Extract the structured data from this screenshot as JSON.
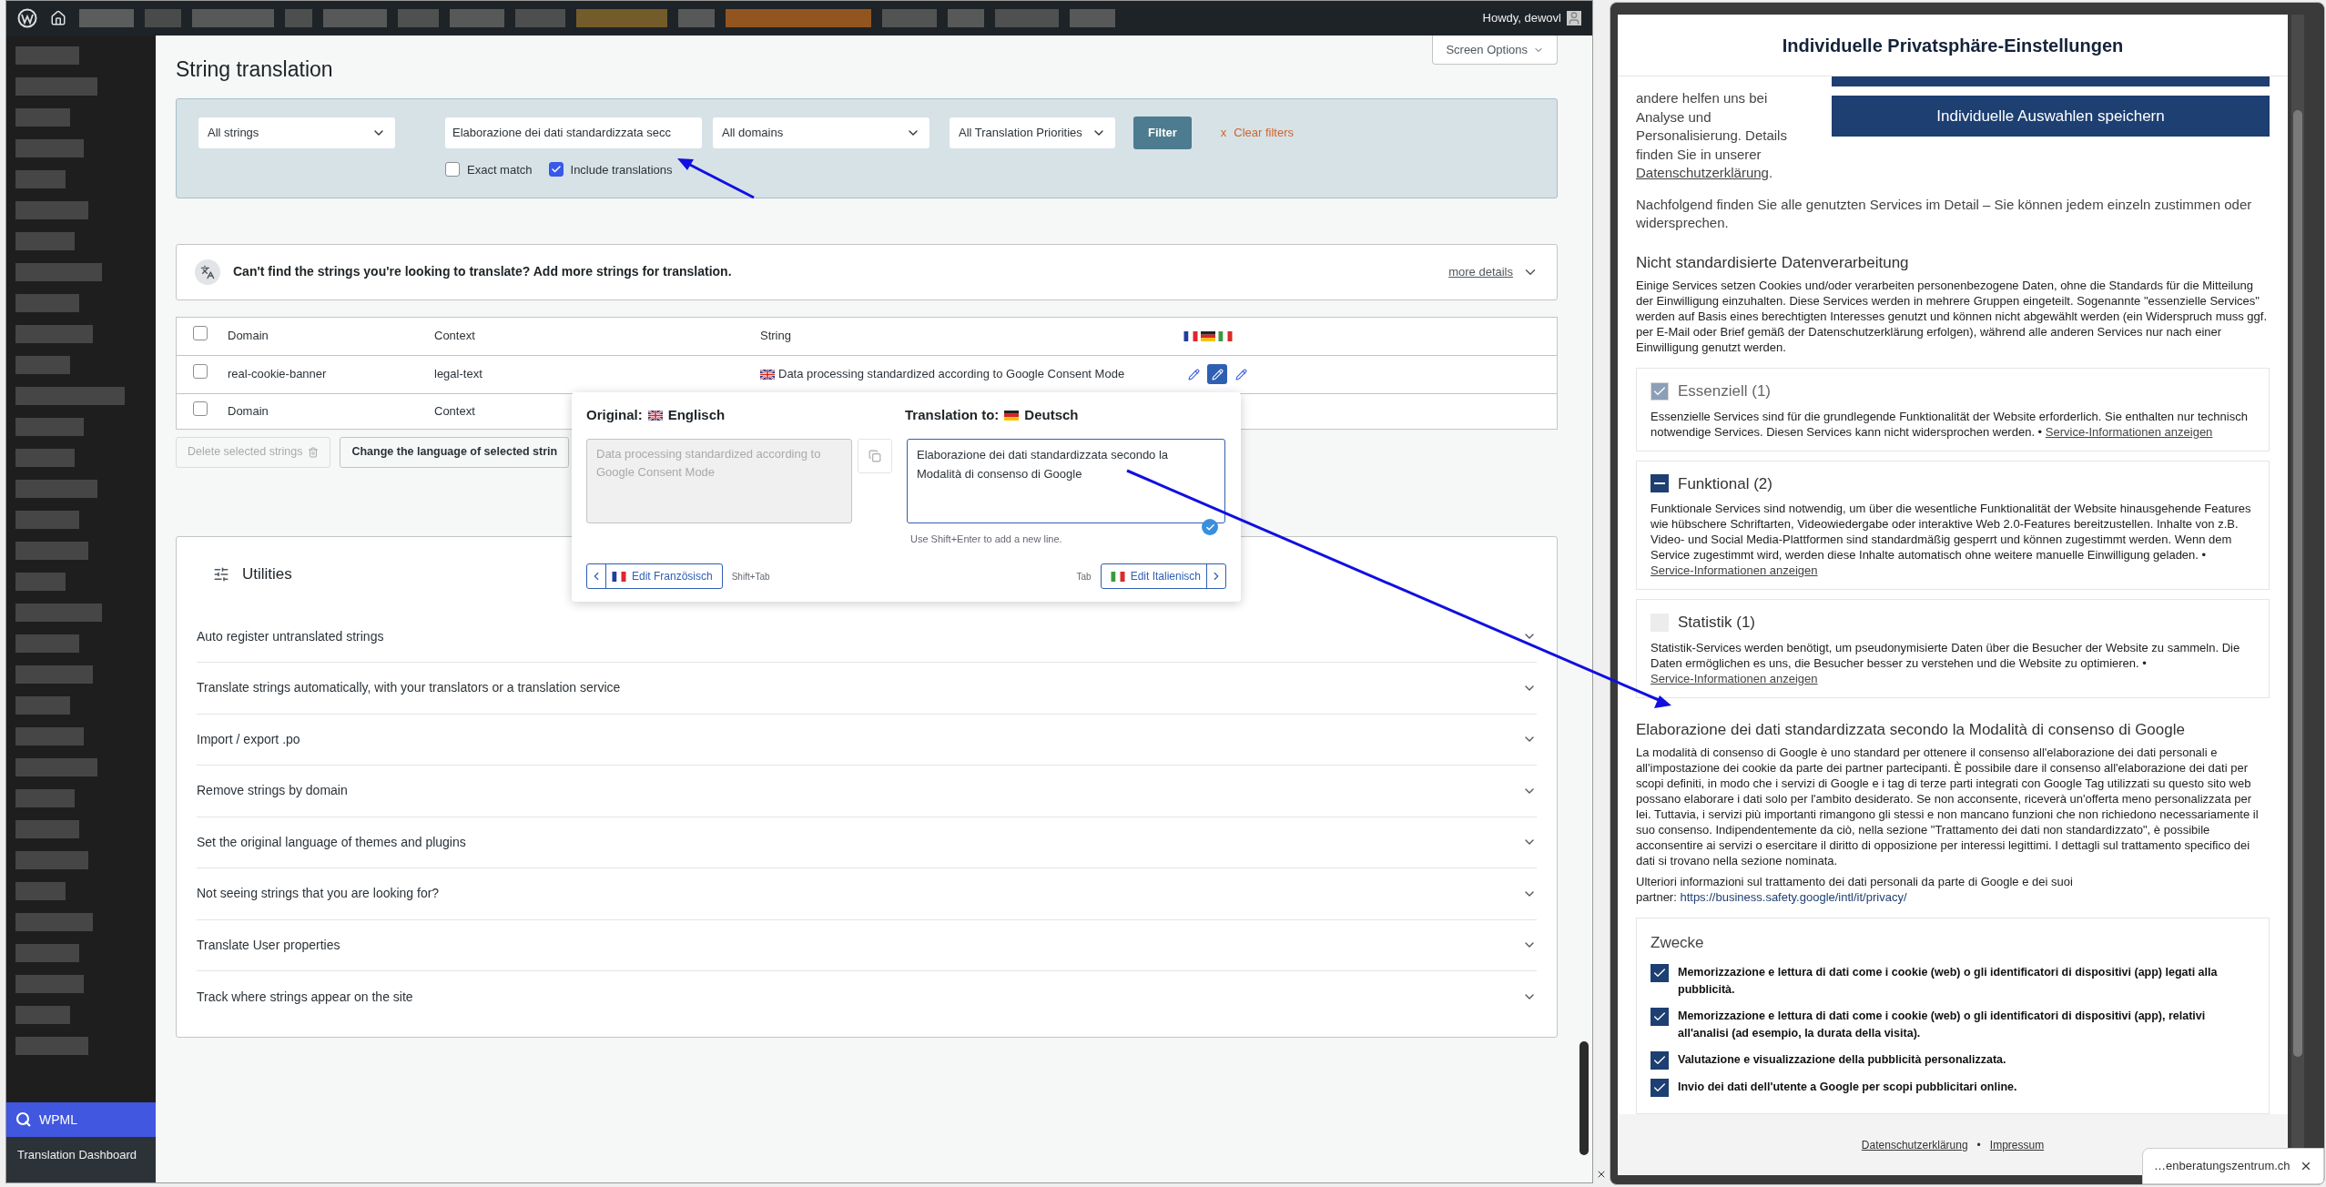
{
  "admin_bar": {
    "greeting": "Howdy, dewovl"
  },
  "sidebar": {
    "menu": [
      {
        "label": "WPML",
        "selected": true
      }
    ],
    "submenu": [
      "Translation Dashboard"
    ]
  },
  "page": {
    "title": "String translation",
    "screen_options": "Screen Options"
  },
  "filters": {
    "string_type": "All strings",
    "search": "Elaborazione dei dati standardizzata secc",
    "domain": "All domains",
    "priority": "All Translation Priorities",
    "filter_button": "Filter",
    "clear_icon": "x",
    "clear_label": "Clear filters",
    "options": [
      {
        "label": "Exact match",
        "checked": false
      },
      {
        "label": "Include translations",
        "checked": true
      }
    ]
  },
  "notice": {
    "text": "Can't find the strings you're looking to translate? Add more strings for translation.",
    "link": "more details"
  },
  "table": {
    "header_checked": false,
    "footer_checked": false,
    "columns": [
      "Domain",
      "Context",
      "String"
    ],
    "rows": [
      {
        "checked": false,
        "domain": "real-cookie-banner",
        "context": "legal-text",
        "string": "Data processing standardized according to Google Consent Mode",
        "editors": [
          {
            "selected": false
          },
          {
            "selected": true
          },
          {
            "selected": false
          }
        ]
      }
    ],
    "footer": [
      "Domain",
      "Context"
    ]
  },
  "bulk_actions": [
    {
      "label": "Delete selected strings",
      "disabled": true
    },
    {
      "label": "Change the language of selected strin",
      "disabled": false
    }
  ],
  "popup": {
    "original_label": "Original:",
    "original_language": "Englisch",
    "translation_label": "Translation to:",
    "translation_language": "Deutsch",
    "original_text": "Data processing standardized according to Google Consent Mode",
    "translation_text": "Elaborazione dei dati standardizzata secondo la Modalità di consenso di Google",
    "hint": "Use Shift+Enter to add a new line.",
    "prev": {
      "label": "Edit Französisch",
      "shortcut": "Shift+Tab"
    },
    "next": {
      "label": "Edit Italienisch",
      "shortcut": "Tab"
    }
  },
  "utilities": {
    "title": "Utilities",
    "items": [
      {
        "label": "Auto register untranslated strings",
        "expanded": false
      },
      {
        "label": "Translate strings automatically, with your translators or a translation service",
        "expanded": false
      },
      {
        "label": "Import / export .po",
        "expanded": false
      },
      {
        "label": "Remove strings by domain",
        "expanded": false
      },
      {
        "label": "Set the original language of themes and plugins",
        "expanded": false
      },
      {
        "label": "Not seeing strings that you are looking for?",
        "expanded": false
      },
      {
        "label": "Translate User properties",
        "expanded": false
      },
      {
        "label": "Track where strings appear on the site",
        "expanded": false
      }
    ]
  },
  "consent_dialog": {
    "title": "Individuelle Privatsphäre-Einstellungen",
    "intro": {
      "text": "andere helfen uns bei Analyse und Personalisierung. Details finden Sie in unserer",
      "link": "Datenschutzerklärung",
      "end": "."
    },
    "save_button": "Individuelle Auswahlen speichern",
    "summary": "Nachfolgend finden Sie alle genutzten Services im Detail – Sie können jedem einzeln zustimmen oder widersprechen.",
    "section_heading": "Nicht standardisierte Datenverarbeitung",
    "section_text": "Einige Services setzen Cookies und/oder verarbeiten personenbezogene Daten, ohne die Standards für die Mitteilung der Einwilligung einzuhalten. Diese Services werden in mehrere Gruppen eingeteilt. Sogenannte \"essenzielle Services\" werden auf Basis eines berechtigten Interesses genutzt und können nicht abgewählt werden (ein Widerspruch muss ggf. per E-Mail oder Brief gemäß der Datenschutzerklärung erfolgen), während alle anderen Services nur nach einer Einwilligung genutzt werden.",
    "groups": [
      {
        "kind": "checkbox",
        "title": "Essenziell (1)",
        "checked": true,
        "disabled": true,
        "text": "Essenzielle Services sind für die grundlegende Funktionalität der Website erforderlich. Sie enthalten nur technisch notwendige Services. Diesen Services kann nicht widersprochen werden. •",
        "link": "Service-Informationen anzeigen"
      },
      {
        "kind": "tristate",
        "title": "Funktional (2)",
        "checked": true,
        "disabled": false,
        "text": "Funktionale Services sind notwendig, um über die wesentliche Funktionalität der Website hinausgehende Features wie hübschere Schriftarten, Videowiedergabe oder interaktive Web 2.0-Features bereitzustellen. Inhalte von z.B. Video- und Social Media-Plattformen sind standardmäßig gesperrt und können zugestimmt werden. Wenn dem Service zugestimmt wird, werden diese Inhalte automatisch ohne weitere manuelle Einwilligung geladen. •",
        "link": "Service-Informationen anzeigen"
      },
      {
        "kind": "checkbox",
        "title": "Statistik (1)",
        "checked": false,
        "disabled": false,
        "text": "Statistik-Services werden benötigt, um pseudonymisierte Daten über die Besucher der Website zu sammeln. Die Daten ermöglichen es uns, die Besucher besser zu verstehen und die Website zu optimieren. •",
        "link": "Service-Informationen anzeigen"
      }
    ],
    "google_heading": "Elaborazione dei dati standardizzata secondo la Modalità di consenso di Google",
    "google_text": "La modalità di consenso di Google è uno standard per ottenere il consenso all'elaborazione dei dati personali e all'impostazione dei cookie da parte dei partner partecipanti. È possibile dare il consenso all'elaborazione dei dati per scopi definiti, in modo che i servizi di Google e i tag di terze parti integrati con Google Tag utilizzati su questo sito web possano elaborare i dati solo per l'ambito desiderato. Se non acconsente, riceverà un'offerta meno personalizzata per lei. Tuttavia, i servizi più importanti rimangono gli stessi e non mancano funzioni che non richiedono necessariamente il suo consenso. Indipendentemente da ciò, nella sezione \"Trattamento dei dati non standardizzato\", è possibile acconsentire ai servizi o esercitare il diritto di opposizione per interessi legittimi. I dettagli sul trattamento specifico dei dati si trovano nella sezione nominata.",
    "google_more": "Ulteriori informazioni sul trattamento dei dati personali da parte di Google e dei suoi partner:",
    "google_link": "https://business.safety.google/intl/it/privacy/",
    "purposes": {
      "title": "Zwecke",
      "items": [
        {
          "label": "Memorizzazione e lettura di dati come i cookie (web) o gli identificatori di dispositivi (app) legati alla pubblicità.",
          "checked": true
        },
        {
          "label": "Memorizzazione e lettura di dati come i cookie (web) o gli identificatori di dispositivi (app), relativi all'analisi (ad esempio, la durata della visita).",
          "checked": true
        },
        {
          "label": "Valutazione e visualizzazione della pubblicità personalizzata.",
          "checked": true
        },
        {
          "label": "Invio dei dati dell'utente a Google per scopi pubblicitari online.",
          "checked": true
        }
      ]
    },
    "footer_links": [
      "Datenschutzerklärung",
      "Impressum"
    ],
    "footer_separator": "•"
  },
  "url_tooltip": "…enberatungszentrum.ch"
}
